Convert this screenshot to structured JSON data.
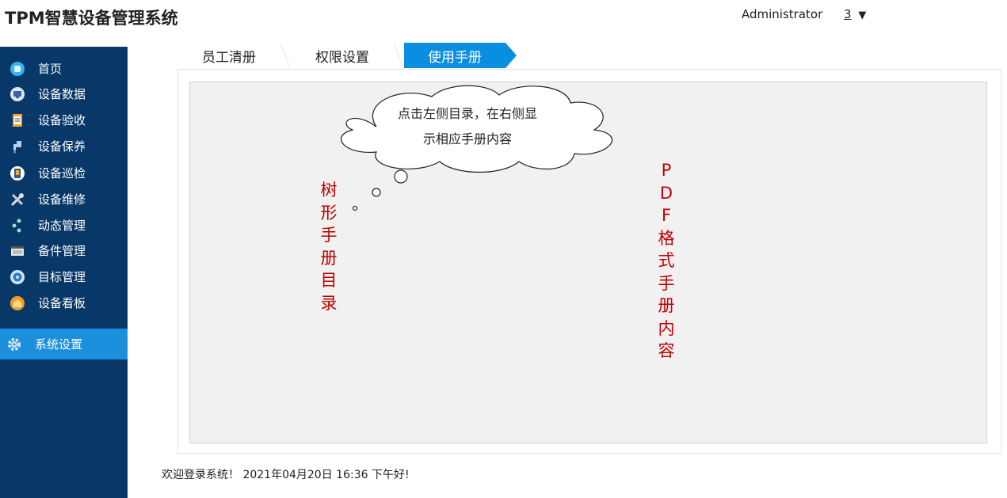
{
  "header": {
    "app_title": "TPM智慧设备管理系统",
    "username": "Administrator",
    "notification_count": "3",
    "caret": "▼"
  },
  "sidebar": {
    "items": [
      {
        "label": "首页",
        "icon": "home-icon"
      },
      {
        "label": "设备数据",
        "icon": "monitor-icon"
      },
      {
        "label": "设备验收",
        "icon": "clipboard-icon"
      },
      {
        "label": "设备保养",
        "icon": "faucet-icon"
      },
      {
        "label": "设备巡检",
        "icon": "checklist-icon"
      },
      {
        "label": "设备维修",
        "icon": "tools-icon"
      },
      {
        "label": "动态管理",
        "icon": "share-icon"
      },
      {
        "label": "备件管理",
        "icon": "film-icon"
      },
      {
        "label": "目标管理",
        "icon": "target-icon"
      },
      {
        "label": "设备看板",
        "icon": "dashboard-icon"
      }
    ],
    "active_item": {
      "label": "系统设置",
      "icon": "gear-icon"
    }
  },
  "tabs": [
    {
      "label": "员工清册",
      "active": false
    },
    {
      "label": "权限设置",
      "active": false
    },
    {
      "label": "使用手册",
      "active": true
    }
  ],
  "callout": {
    "line1": "点击左侧目录，在右侧显",
    "line2": "示相应手册内容"
  },
  "tree_panel": {
    "label": "树形手册目录"
  },
  "pdf_panel": {
    "label": "PDF格式手册内容"
  },
  "footer": {
    "status": "欢迎登录系统！ 2021年04月20日 16:36 下午好!"
  },
  "colors": {
    "sidebar_bg": "#073868",
    "sidebar_active": "#1c8fdc",
    "tab_active": "#0a8fe0",
    "annotation_red": "#c00000"
  }
}
